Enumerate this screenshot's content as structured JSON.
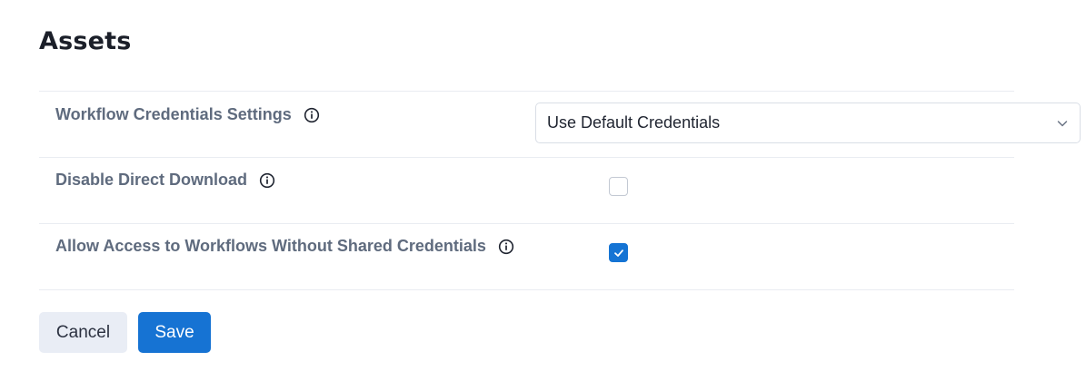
{
  "header": {
    "title": "Assets"
  },
  "settings": {
    "workflow_credentials": {
      "label": "Workflow Credentials Settings",
      "selected": "Use Default Credentials",
      "icon": "info-icon"
    },
    "disable_direct_download": {
      "label": "Disable Direct Download",
      "checked": false,
      "icon": "info-icon"
    },
    "allow_access": {
      "label": "Allow Access to Workflows Without Shared Credentials",
      "checked": true,
      "icon": "info-icon"
    }
  },
  "actions": {
    "cancel_label": "Cancel",
    "save_label": "Save"
  },
  "colors": {
    "primary": "#1673d3",
    "cancel_bg": "#e9edf5",
    "label": "#5f6b7e",
    "divider": "#e9ecf2"
  }
}
